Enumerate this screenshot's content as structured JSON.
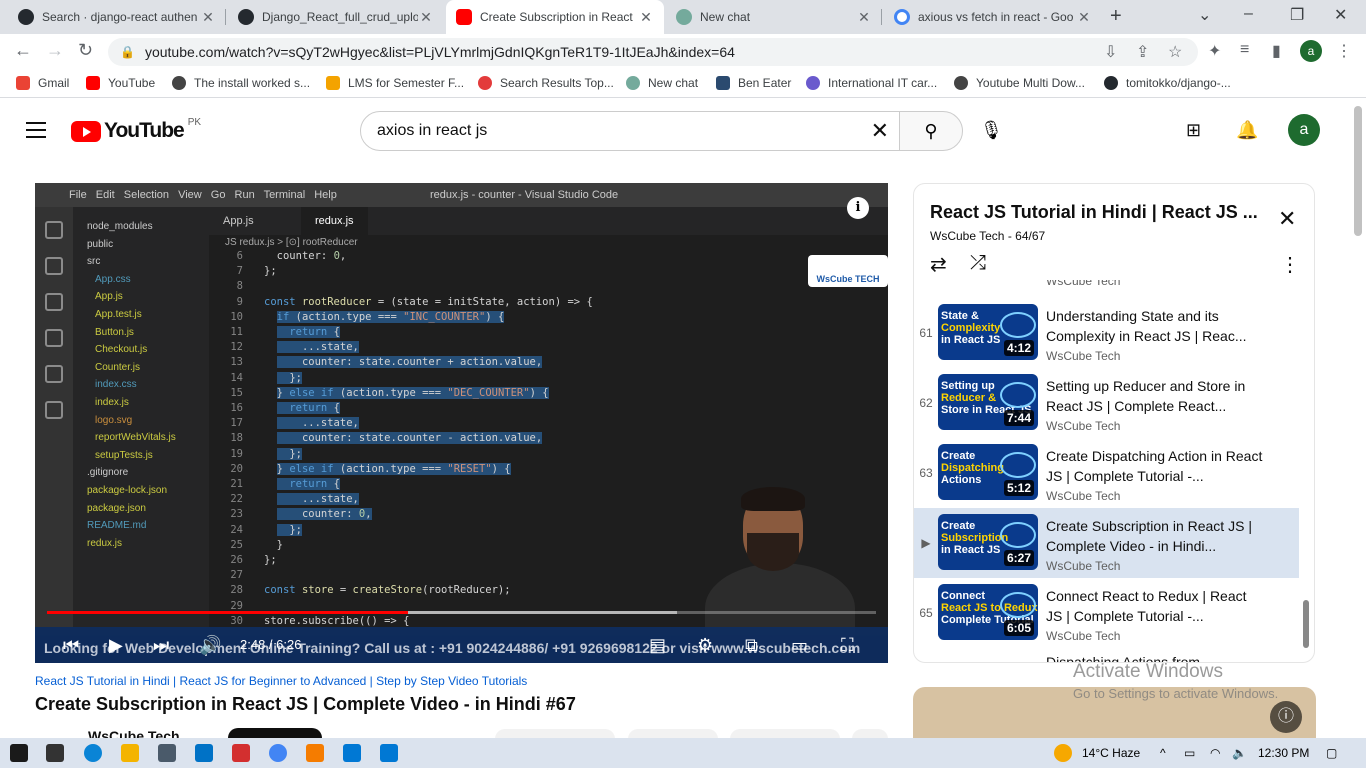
{
  "browser": {
    "tabs": [
      {
        "title": "Search · django-react authen",
        "icon_color": "#24292f"
      },
      {
        "title": "Django_React_full_crud_uplo",
        "icon_color": "#24292f"
      },
      {
        "title": "Create Subscription in React",
        "icon_color": "#ff0000"
      },
      {
        "title": "New chat",
        "icon_color": "#74aa9c"
      },
      {
        "title": "axious vs fetch in react - Goo",
        "icon_color": "#4285f4"
      }
    ],
    "new_tab": "+",
    "url": "youtube.com/watch?v=sQyT2wHgyec&list=PLjVLYmrlmjGdnIQKgnTeR1T9-1ItJEaJh&index=64",
    "profile_letter": "a",
    "bookmarks": [
      {
        "label": "Gmail",
        "color": "#ea4335"
      },
      {
        "label": "YouTube",
        "color": "#ff0000"
      },
      {
        "label": "The install worked s...",
        "color": "#444444"
      },
      {
        "label": "LMS for Semester F...",
        "color": "#f4a300"
      },
      {
        "label": "Search Results Top...",
        "color": "#e33b3b"
      },
      {
        "label": "New chat",
        "color": "#74aa9c"
      },
      {
        "label": "Ben Eater",
        "color": "#2b4a6f"
      },
      {
        "label": "International IT car...",
        "color": "#6a5acd"
      },
      {
        "label": "Youtube Multi Dow...",
        "color": "#444444"
      },
      {
        "label": "tomitokko/django-...",
        "color": "#24292f"
      }
    ]
  },
  "youtube": {
    "logo_text": "YouTube",
    "country": "PK",
    "search_value": "axios in react js",
    "avatar_letter": "a"
  },
  "player": {
    "vscode_menu": "File  Edit  Selection  View  Go  Run  Terminal  Help",
    "vscode_title": "redux.js - counter - Visual Studio Code",
    "tab_app": "App.js",
    "tab_redux": "redux.js",
    "breadcrumb": "JS redux.js > [⊙] rootReducer",
    "explorer": [
      "node_modules",
      "public",
      "src",
      "App.css",
      "App.js",
      "App.test.js",
      "Button.js",
      "Checkout.js",
      "Counter.js",
      "index.css",
      "index.js",
      "logo.svg",
      "reportWebVitals.js",
      "setupTests.js",
      ".gitignore",
      "package-lock.json",
      "package.json",
      "README.md",
      "redux.js"
    ],
    "line_numbers": [
      "6",
      "7",
      "8",
      "9",
      "10",
      "11",
      "12",
      "13",
      "14",
      "15",
      "16",
      "17",
      "18",
      "19",
      "20",
      "21",
      "22",
      "23",
      "24",
      "25",
      "26",
      "27",
      "28",
      "29",
      "30"
    ],
    "wscube_logo": "WsCube TECH",
    "time_current": "2:48",
    "time_total": "6:26",
    "time_display": "2:48 / 6:26",
    "progress_fraction": 0.435,
    "buffered_fraction": 0.76,
    "ticker": "Looking for Web Development Online Training? Call us at : +91 9024244886/ +91 9269698122 or visit www.wscubetech.com"
  },
  "video": {
    "hashtags": "React JS Tutorial in Hindi | React JS for Beginner to Advanced | Step by Step Video Tutorials",
    "title": "Create Subscription in React JS | Complete Video - in Hindi #67",
    "channel": "WsCube Tech"
  },
  "playlist": {
    "title": "React JS Tutorial in Hindi | React JS ...",
    "meta": "WsCube Tech - 64/67",
    "top_partial_channel": "WsCube Tech",
    "items": [
      {
        "index": "61",
        "title": "Understanding State and its Complexity in React JS | Reac...",
        "channel": "WsCube Tech",
        "duration": "4:12",
        "thumb_line1": "State &",
        "thumb_line2": "Complexity",
        "thumb_line3": "in React JS"
      },
      {
        "index": "62",
        "title": "Setting up Reducer and Store in React JS | Complete React...",
        "channel": "WsCube Tech",
        "duration": "7:44",
        "thumb_line1": "Setting up",
        "thumb_line2": "Reducer &",
        "thumb_line3": "Store in React JS"
      },
      {
        "index": "63",
        "title": "Create Dispatching Action in React JS | Complete Tutorial -...",
        "channel": "WsCube Tech",
        "duration": "5:12",
        "thumb_line1": "Create",
        "thumb_line2": "Dispatching",
        "thumb_line3": "Actions"
      },
      {
        "index": "▶",
        "title": "Create Subscription in React JS | Complete Video - in Hindi...",
        "channel": "WsCube Tech",
        "duration": "6:27",
        "thumb_line1": "Create",
        "thumb_line2": "Subscription",
        "thumb_line3": "in React JS"
      },
      {
        "index": "65",
        "title": "Connect React to Redux | React JS | Complete Tutorial -...",
        "channel": "WsCube Tech",
        "duration": "6:05",
        "thumb_line1": "Connect",
        "thumb_line2": "React JS to Redux",
        "thumb_line3": "Complete Tutorial"
      }
    ],
    "partial_next_title": "Dispatching Actions from"
  },
  "windows": {
    "activate_title": "Activate Windows",
    "activate_sub": "Go to Settings to activate Windows.",
    "weather": "14°C  Haze",
    "clock": "12:30 PM"
  }
}
